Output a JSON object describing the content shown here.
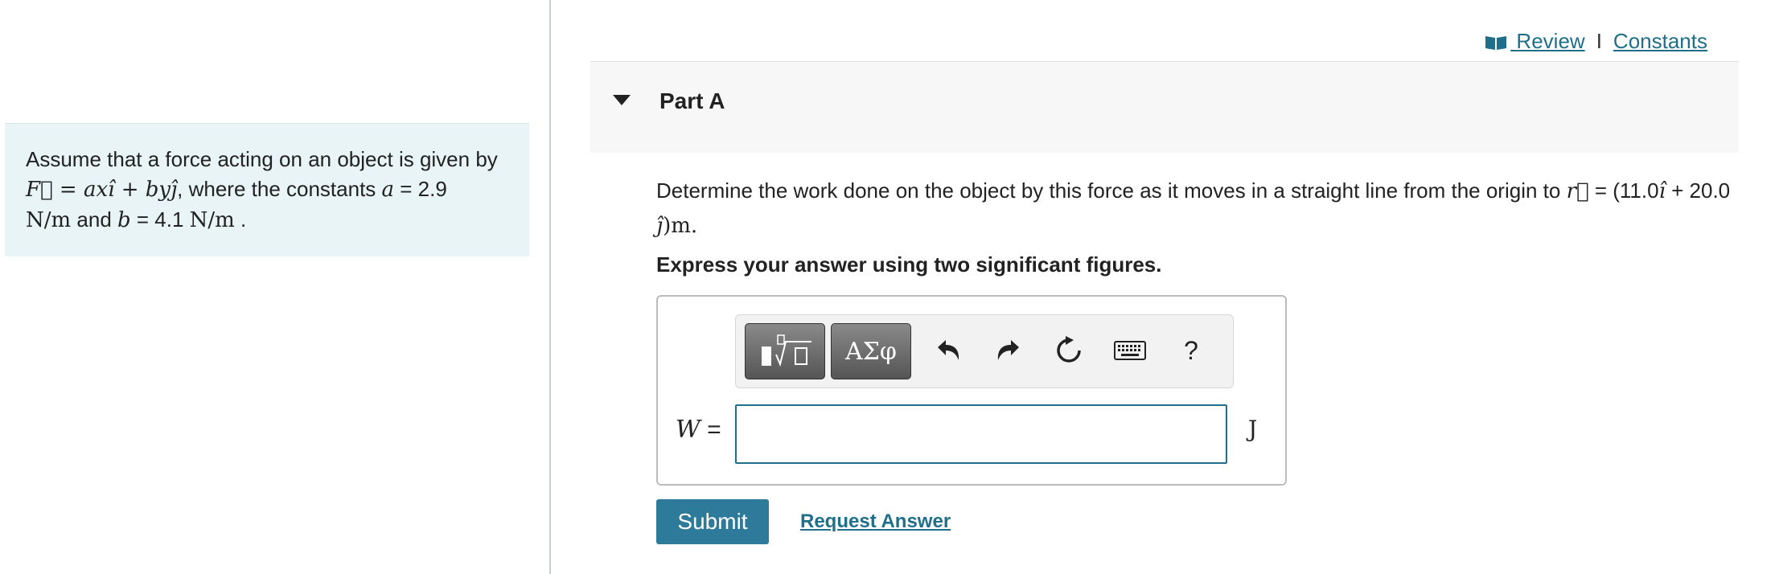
{
  "header": {
    "review_label": " Review",
    "separator": "I",
    "constants_label": "Constants",
    "book_icon": "book-icon"
  },
  "left": {
    "intro_text": "Assume that a force acting on an object is given by",
    "force_expr": "F⃗ = axî + byĵ",
    "where_text": ", where the constants",
    "a_var": "a",
    "a_value": " = 2.9",
    "a_unit": "N/m",
    "and_text": " and ",
    "b_var": "b",
    "b_value": " = 4.1 ",
    "b_unit": "N/m",
    "end": " ."
  },
  "part": {
    "title": "Part A",
    "collapse_icon": "triangle-down-icon"
  },
  "question": {
    "text": "Determine the work done on the object by this force as it moves in a straight line from the origin to ",
    "r_symbol": "r⃗",
    "eq": " = (11.0",
    "i_hat": "î",
    "plus": " + 20.0 ",
    "j_hat": "ĵ",
    "tail": ")m."
  },
  "instruction": "Express your answer using two significant figures.",
  "toolbar": {
    "symbols_label": "ΑΣφ",
    "help_label": "?"
  },
  "answer": {
    "var_label": "W",
    "equals": " =",
    "value": "",
    "unit": "J"
  },
  "actions": {
    "submit_label": "Submit",
    "request_label": "Request Answer"
  },
  "colors": {
    "accent": "#1f6f8b",
    "submit_bg": "#2e7a9a",
    "left_panel_bg": "#e8f4f5",
    "part_header_bg": "#f7f7f7"
  }
}
